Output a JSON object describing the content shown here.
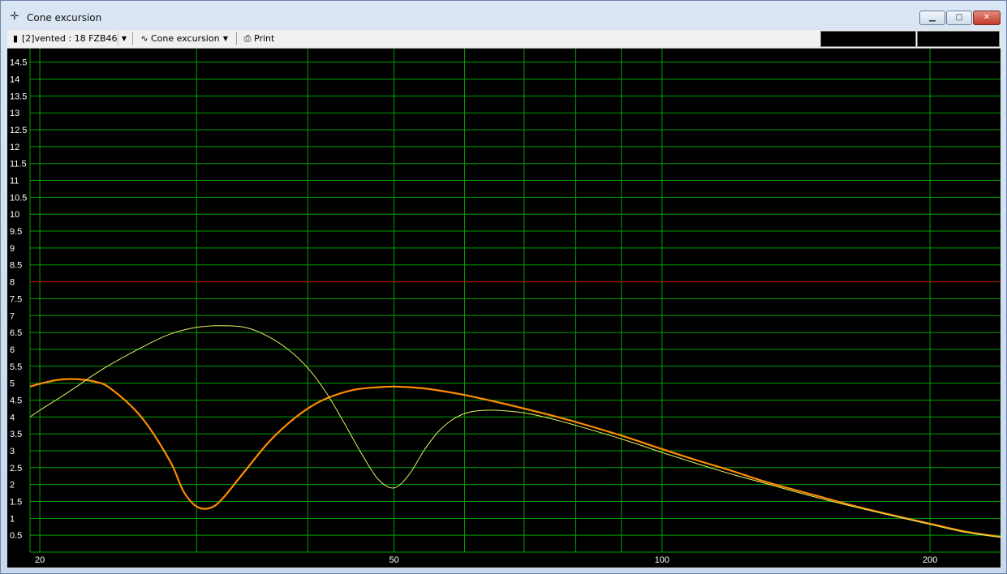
{
  "window": {
    "title": "Cone excursion",
    "title_icon": "crosshair-icon",
    "buttons": {
      "minimize_icon": "minimize-icon",
      "maximize_icon": "maximize-icon",
      "close_icon": "close-icon"
    }
  },
  "toolbar": {
    "project_label": "[2]vented : 18 FZB46",
    "graph_label": "Cone excursion",
    "print_label": "Print"
  },
  "colors": {
    "background": "#000000",
    "grid": "#00a000",
    "limit_line": "#c00000",
    "series_orange": "#ff8c00",
    "series_yellow": "#e8f060"
  },
  "chart_data": {
    "type": "line",
    "x_scale": "log",
    "xlim": [
      19.5,
      240
    ],
    "ylim": [
      0,
      14.9
    ],
    "x_ticks": [
      20,
      50,
      100,
      200
    ],
    "y_ticks": [
      0.5,
      1,
      1.5,
      2,
      2.5,
      3,
      3.5,
      4,
      4.5,
      5,
      5.5,
      6,
      6.5,
      7,
      7.5,
      8,
      8.5,
      9,
      9.5,
      10,
      10.5,
      11,
      11.5,
      12,
      12.5,
      13,
      13.5,
      14,
      14.5
    ],
    "grid": true,
    "limit_line_y": 8,
    "series": [
      {
        "color": "#ff8c00",
        "x": [
          19.5,
          20,
          21,
          22,
          23,
          24,
          26,
          28,
          29,
          30,
          31,
          32,
          34,
          36,
          38,
          40,
          42,
          45,
          48,
          50,
          52,
          55,
          60,
          65,
          70,
          75,
          80,
          90,
          100,
          110,
          120,
          130,
          150,
          170,
          200,
          220,
          240
        ],
        "y": [
          4.9,
          4.98,
          5.1,
          5.12,
          5.05,
          4.85,
          4.0,
          2.7,
          1.8,
          1.35,
          1.3,
          1.55,
          2.4,
          3.2,
          3.8,
          4.25,
          4.55,
          4.8,
          4.88,
          4.9,
          4.88,
          4.82,
          4.65,
          4.45,
          4.25,
          4.05,
          3.85,
          3.45,
          3.05,
          2.7,
          2.4,
          2.1,
          1.65,
          1.27,
          0.84,
          0.6,
          0.45
        ]
      },
      {
        "color": "#e8f060",
        "x": [
          19.5,
          20,
          21,
          22,
          23,
          24,
          26,
          28,
          30,
          32,
          34,
          36,
          38,
          40,
          42,
          44,
          46,
          48,
          50,
          52,
          54,
          56,
          58,
          60,
          62,
          65,
          70,
          75,
          80,
          90,
          100,
          110,
          120,
          130,
          150,
          170,
          200,
          220,
          240
        ],
        "y": [
          4.0,
          4.2,
          4.55,
          4.9,
          5.25,
          5.55,
          6.05,
          6.45,
          6.65,
          6.7,
          6.65,
          6.4,
          6.0,
          5.45,
          4.7,
          3.8,
          2.9,
          2.15,
          1.9,
          2.3,
          3.0,
          3.55,
          3.9,
          4.1,
          4.18,
          4.2,
          4.12,
          3.95,
          3.75,
          3.35,
          2.95,
          2.6,
          2.3,
          2.05,
          1.6,
          1.25,
          0.82,
          0.58,
          0.44
        ]
      }
    ]
  }
}
